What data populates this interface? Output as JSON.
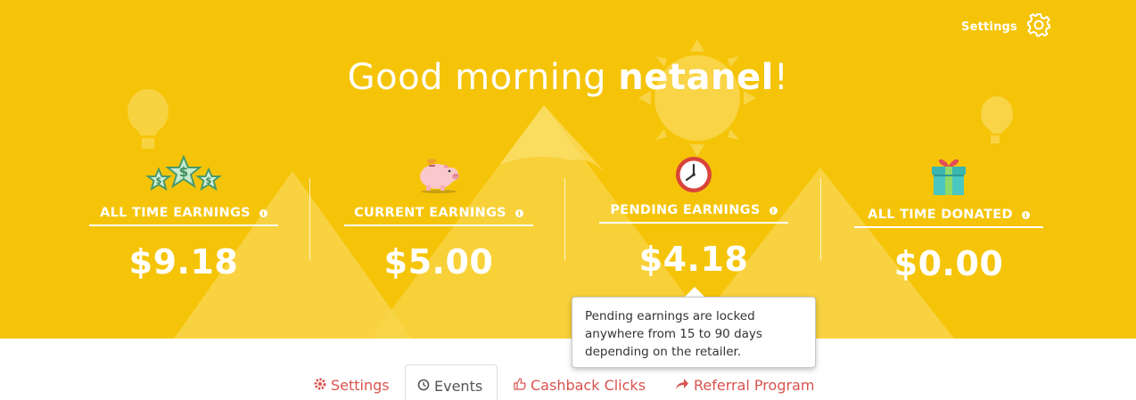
{
  "header": {
    "settings_label": "Settings",
    "greeting_prefix": "Good morning ",
    "username": "netanel",
    "greeting_suffix": "!"
  },
  "stats": [
    {
      "title": "ALL TIME EARNINGS",
      "amount": "$9.18",
      "icon": "stars-icon"
    },
    {
      "title": "CURRENT EARNINGS",
      "amount": "$5.00",
      "icon": "piggy-bank-icon"
    },
    {
      "title": "PENDING EARNINGS",
      "amount": "$4.18",
      "icon": "clock-icon"
    },
    {
      "title": "ALL TIME DONATED",
      "amount": "$0.00",
      "icon": "gift-icon"
    }
  ],
  "tooltip": {
    "text": "Pending earnings are locked anywhere from 15 to 90 days depending on the retailer."
  },
  "tabs": [
    {
      "label": "Settings",
      "icon": "gear-icon",
      "active": false
    },
    {
      "label": "Events",
      "icon": "clock-icon",
      "active": true
    },
    {
      "label": "Cashback Clicks",
      "icon": "thumbs-up-icon",
      "active": false
    },
    {
      "label": "Referral Program",
      "icon": "share-arrow-icon",
      "active": false
    }
  ],
  "colors": {
    "hero_background": "#f5c408",
    "tab_link": "#d9534f",
    "text_white": "#ffffff"
  }
}
